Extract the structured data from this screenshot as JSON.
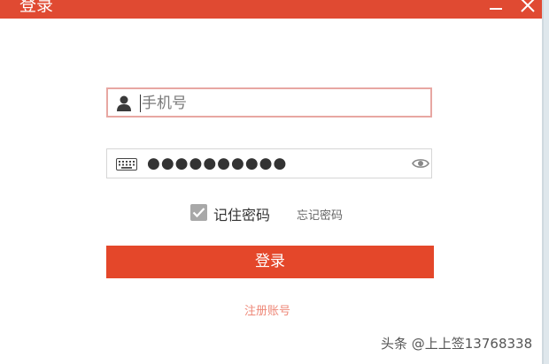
{
  "window": {
    "title": "登录",
    "accent_color": "#e04a32",
    "controls": [
      "minimize-icon",
      "close-icon"
    ]
  },
  "form": {
    "phone": {
      "icon": "user-icon",
      "placeholder": "手机号",
      "value": ""
    },
    "password": {
      "icon": "keyboard-icon",
      "masked_value": "●●●●●●●●●●",
      "toggle_icon": "eye-icon"
    },
    "remember_label": "记住密码",
    "remember_checked": true,
    "forgot_label": "忘记密码",
    "submit_label": "登录",
    "submit_color": "#e4472a",
    "register_label": "注册账号"
  },
  "watermark": "头条 @上上签13768338"
}
